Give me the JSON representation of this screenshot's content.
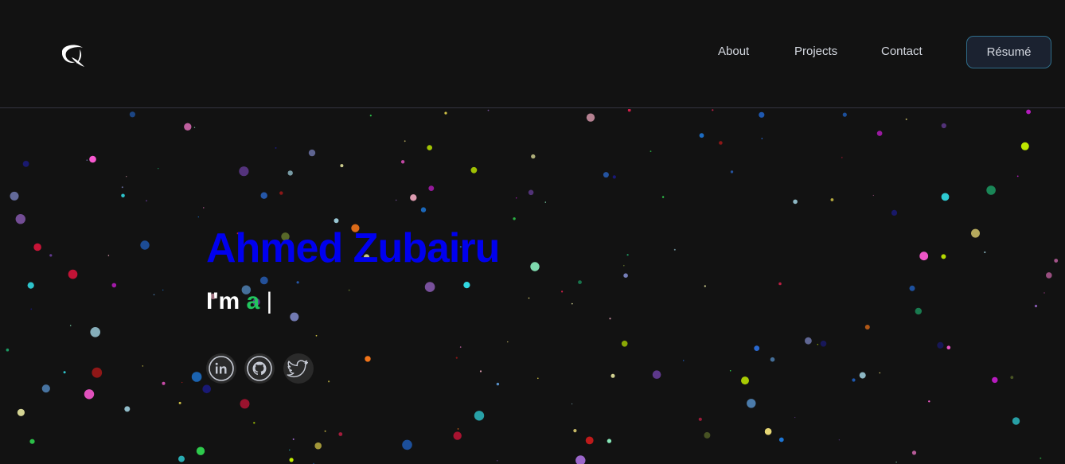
{
  "nav": {
    "links": [
      {
        "label": "About"
      },
      {
        "label": "Projects"
      },
      {
        "label": "Contact"
      }
    ],
    "resume_label": "Résumé"
  },
  "hero": {
    "name": "Ahmed Zubairu",
    "tagline_prefix": "I'm",
    "tagline_typed": "a",
    "cursor": "|"
  },
  "socials": [
    {
      "icon": "linkedin-icon"
    },
    {
      "icon": "github-icon"
    },
    {
      "icon": "twitter-icon"
    }
  ],
  "colors": {
    "background": "#121212",
    "name": "#0000ee",
    "typed": "#22c55e",
    "nav_text": "#d4d8e0",
    "button_border": "#2f6d8a"
  }
}
